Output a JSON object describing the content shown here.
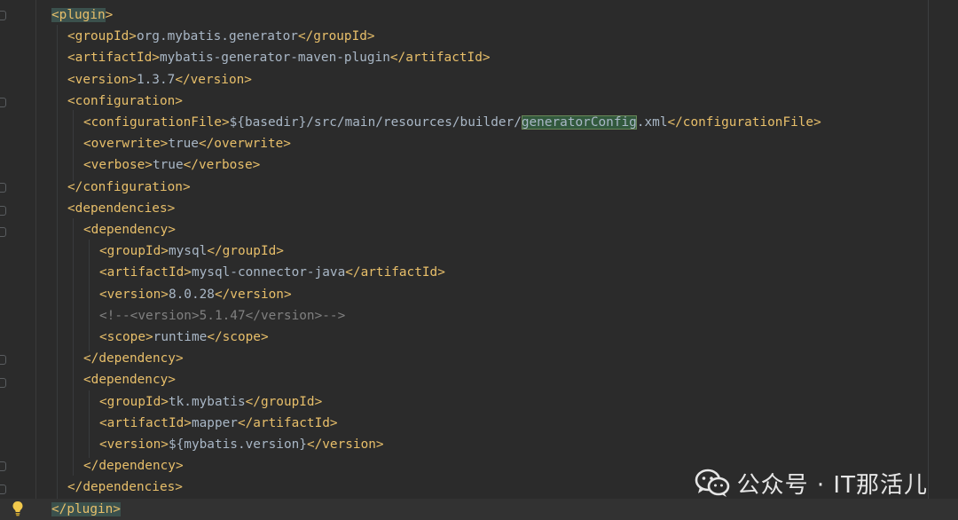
{
  "editor": {
    "lines": [
      {
        "indent": 0,
        "parts": [
          {
            "k": "t",
            "v": "<plugin"
          },
          {
            "k": "t",
            "v": ">"
          }
        ]
      },
      {
        "indent": 1,
        "parts": [
          {
            "k": "t",
            "v": "<groupId>"
          },
          {
            "k": "txt",
            "v": "org.mybatis.generator"
          },
          {
            "k": "t",
            "v": "</groupId>"
          }
        ]
      },
      {
        "indent": 1,
        "parts": [
          {
            "k": "t",
            "v": "<artifactId>"
          },
          {
            "k": "txt",
            "v": "mybatis-generator-maven-plugin"
          },
          {
            "k": "t",
            "v": "</artifactId>"
          }
        ]
      },
      {
        "indent": 1,
        "parts": [
          {
            "k": "t",
            "v": "<version>"
          },
          {
            "k": "txt",
            "v": "1.3.7"
          },
          {
            "k": "t",
            "v": "</version>"
          }
        ]
      },
      {
        "indent": 1,
        "parts": [
          {
            "k": "t",
            "v": "<configuration>"
          }
        ]
      },
      {
        "indent": 2,
        "parts": [
          {
            "k": "t",
            "v": "<configurationFile>"
          },
          {
            "k": "txt",
            "v": "${basedir}/src/main/resources/builder/"
          },
          {
            "k": "found",
            "v": "generatorConfig"
          },
          {
            "k": "txt",
            "v": ".xml"
          },
          {
            "k": "t",
            "v": "</configurationFile>"
          }
        ]
      },
      {
        "indent": 2,
        "parts": [
          {
            "k": "t",
            "v": "<overwrite>"
          },
          {
            "k": "txt",
            "v": "true"
          },
          {
            "k": "t",
            "v": "</overwrite>"
          }
        ]
      },
      {
        "indent": 2,
        "parts": [
          {
            "k": "t",
            "v": "<verbose>"
          },
          {
            "k": "txt",
            "v": "true"
          },
          {
            "k": "t",
            "v": "</verbose>"
          }
        ]
      },
      {
        "indent": 1,
        "parts": [
          {
            "k": "t",
            "v": "</configuration>"
          }
        ]
      },
      {
        "indent": 1,
        "parts": [
          {
            "k": "t",
            "v": "<dependencies>"
          }
        ]
      },
      {
        "indent": 2,
        "parts": [
          {
            "k": "t",
            "v": "<dependency>"
          }
        ]
      },
      {
        "indent": 3,
        "parts": [
          {
            "k": "t",
            "v": "<groupId>"
          },
          {
            "k": "txt",
            "v": "mysql"
          },
          {
            "k": "t",
            "v": "</groupId>"
          }
        ]
      },
      {
        "indent": 3,
        "parts": [
          {
            "k": "t",
            "v": "<artifactId>"
          },
          {
            "k": "txt",
            "v": "mysql-connector-java"
          },
          {
            "k": "t",
            "v": "</artifactId>"
          }
        ]
      },
      {
        "indent": 3,
        "parts": [
          {
            "k": "t",
            "v": "<version>"
          },
          {
            "k": "txt",
            "v": "8.0.28"
          },
          {
            "k": "t",
            "v": "</version>"
          }
        ]
      },
      {
        "indent": 3,
        "parts": [
          {
            "k": "cm",
            "v": "<!--<version>5.1.47</version>-->"
          }
        ]
      },
      {
        "indent": 3,
        "parts": [
          {
            "k": "t",
            "v": "<scope>"
          },
          {
            "k": "txt",
            "v": "runtime"
          },
          {
            "k": "t",
            "v": "</scope>"
          }
        ]
      },
      {
        "indent": 2,
        "parts": [
          {
            "k": "t",
            "v": "</dependency>"
          }
        ]
      },
      {
        "indent": 2,
        "parts": [
          {
            "k": "t",
            "v": "<dependency>"
          }
        ]
      },
      {
        "indent": 3,
        "parts": [
          {
            "k": "t",
            "v": "<groupId>"
          },
          {
            "k": "txt",
            "v": "tk.mybatis"
          },
          {
            "k": "t",
            "v": "</groupId>"
          }
        ]
      },
      {
        "indent": 3,
        "parts": [
          {
            "k": "t",
            "v": "<artifactId>"
          },
          {
            "k": "txt",
            "v": "mapper"
          },
          {
            "k": "t",
            "v": "</artifactId>"
          }
        ]
      },
      {
        "indent": 3,
        "parts": [
          {
            "k": "t",
            "v": "<version>"
          },
          {
            "k": "txt",
            "v": "${mybatis.version}"
          },
          {
            "k": "t",
            "v": "</version>"
          }
        ]
      },
      {
        "indent": 2,
        "parts": [
          {
            "k": "t",
            "v": "</dependency>"
          }
        ]
      },
      {
        "indent": 1,
        "parts": [
          {
            "k": "t",
            "v": "</dependencies>"
          }
        ]
      },
      {
        "indent": 0,
        "parts": [
          {
            "k": "t",
            "v": "</plugin>"
          }
        ]
      }
    ],
    "colors": {
      "background": "#2b2b2b",
      "tag": "#e8bf6a",
      "text": "#a9b7c6",
      "comment": "#808080",
      "search_match": "#32593d"
    },
    "gutter_icons": [
      "fold-marker-icon",
      "lightbulb-icon"
    ]
  },
  "watermark": {
    "text": "公众号 · IT那活儿",
    "icon": "wechat-icon"
  }
}
